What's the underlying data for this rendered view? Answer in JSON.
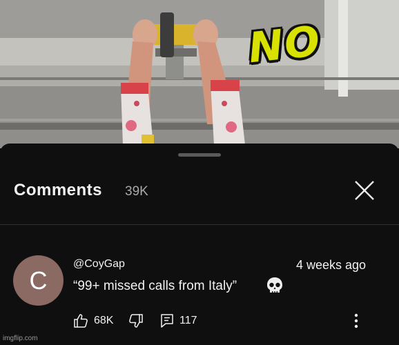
{
  "video": {
    "overlay_text": "NO"
  },
  "comments": {
    "title": "Comments",
    "count": "39K",
    "close_icon": "close-icon"
  },
  "comment": {
    "avatar_letter": "C",
    "avatar_color": "#8b6a63",
    "author": "@CoyGap",
    "timestamp": "4 weeks ago",
    "text": "“99+ missed calls from Italy”",
    "emoji_icon": "skull-icon",
    "likes": "68K",
    "replies": "117"
  },
  "watermark": "imgflip.com"
}
